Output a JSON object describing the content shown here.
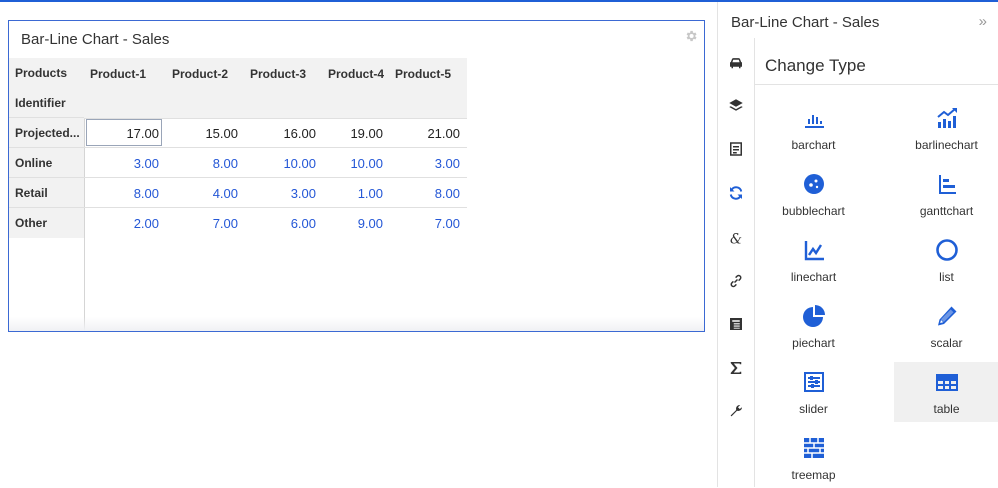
{
  "colors": {
    "accent": "#1f5fd6",
    "value_blue": "#2457d6"
  },
  "widget": {
    "title": "Bar-Line Chart - Sales",
    "settings_icon": "gear-icon",
    "row_headers": [
      "Products",
      "Identifier",
      "Projected...",
      "Online",
      "Retail",
      "Other"
    ],
    "columns": [
      "Product-1",
      "Product-2",
      "Product-3",
      "Product-4",
      "Product-5"
    ],
    "rows": [
      {
        "name": "Projected...",
        "values": [
          "17.00",
          "15.00",
          "16.00",
          "19.00",
          "21.00"
        ]
      },
      {
        "name": "Online",
        "values": [
          "3.00",
          "8.00",
          "10.00",
          "10.00",
          "3.00"
        ]
      },
      {
        "name": "Retail",
        "values": [
          "8.00",
          "4.00",
          "3.00",
          "1.00",
          "8.00"
        ]
      },
      {
        "name": "Other",
        "values": [
          "2.00",
          "7.00",
          "6.00",
          "9.00",
          "7.00"
        ]
      }
    ]
  },
  "panel": {
    "title": "Bar-Line Chart - Sales",
    "collapse": "»",
    "sidebar_icons": [
      "car-icon",
      "layers-icon",
      "document-icon",
      "refresh-icon",
      "ampersand-icon",
      "link-icon",
      "news-icon",
      "sigma-icon",
      "wrench-icon"
    ],
    "section_title": "Change Type",
    "types": [
      {
        "label": "barchart",
        "icon": "bar-chart-icon"
      },
      {
        "label": "barlinechart",
        "icon": "bar-line-chart-icon"
      },
      {
        "label": "bubblechart",
        "icon": "bubble-chart-icon"
      },
      {
        "label": "ganttchart",
        "icon": "gantt-chart-icon"
      },
      {
        "label": "linechart",
        "icon": "line-chart-icon"
      },
      {
        "label": "list",
        "icon": "list-circle-icon"
      },
      {
        "label": "piechart",
        "icon": "pie-chart-icon"
      },
      {
        "label": "scalar",
        "icon": "pencil-icon"
      },
      {
        "label": "slider",
        "icon": "slider-icon"
      },
      {
        "label": "table",
        "icon": "table-icon",
        "selected": true
      },
      {
        "label": "treemap",
        "icon": "treemap-icon"
      }
    ]
  }
}
